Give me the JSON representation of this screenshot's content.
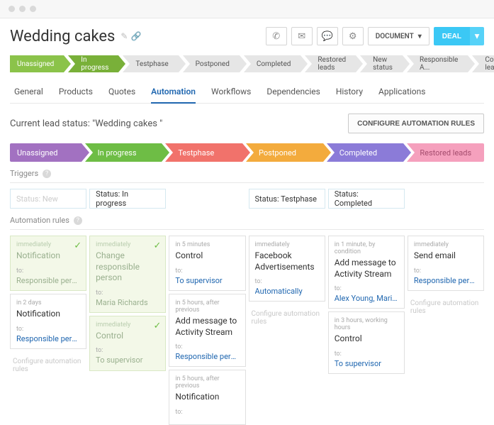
{
  "header": {
    "title": "Wedding cakes",
    "document_btn": "DOCUMENT",
    "deal_btn": "DEAL"
  },
  "top_stages": [
    {
      "label": "Unassigned",
      "cls": "green"
    },
    {
      "label": "In progress",
      "cls": "green dark"
    },
    {
      "label": "Testphase",
      "cls": ""
    },
    {
      "label": "Postponed",
      "cls": ""
    },
    {
      "label": "Completed",
      "cls": ""
    },
    {
      "label": "Restored leads",
      "cls": ""
    },
    {
      "label": "New status",
      "cls": ""
    },
    {
      "label": "Responsible A...",
      "cls": ""
    },
    {
      "label": "Complete lead",
      "cls": ""
    }
  ],
  "tabs": [
    "General",
    "Products",
    "Quotes",
    "Automation",
    "Workflows",
    "Dependencies",
    "History",
    "Applications"
  ],
  "active_tab": "Automation",
  "status_text": "Current lead status: \"Wedding cakes \"",
  "config_btn": "CONFIGURE AUTOMATION RULES",
  "stage_columns": [
    {
      "label": "Unassigned",
      "cls": "c-purple"
    },
    {
      "label": "In progress",
      "cls": "c-green"
    },
    {
      "label": "Testphase",
      "cls": "c-red"
    },
    {
      "label": "Postponed",
      "cls": "c-orange"
    },
    {
      "label": "Completed",
      "cls": "c-violet"
    },
    {
      "label": "Restored leads",
      "cls": "c-pink"
    }
  ],
  "triggers_label": "Triggers",
  "rules_label": "Automation rules",
  "ghost": "Configure automation rules",
  "to_label": "to:",
  "columns": [
    {
      "trigger": {
        "text": "Status: New",
        "faded": true
      },
      "cards": [
        {
          "done": true,
          "timing": "immediately",
          "title": "Notification",
          "to": "Responsible person"
        },
        {
          "done": false,
          "timing": "in 2 days",
          "title": "Notification",
          "to": "Responsible person"
        }
      ],
      "tail_ghost": true
    },
    {
      "trigger": {
        "text": "Status: In progress",
        "faded": false
      },
      "cards": [
        {
          "done": true,
          "timing": "immediately",
          "title": "Change responsible person",
          "to": "Maria Richards"
        },
        {
          "done": true,
          "timing": "immediately",
          "title": "Control",
          "to": "To supervisor"
        }
      ],
      "tail_ghost": false
    },
    {
      "trigger": null,
      "cards": [
        {
          "done": false,
          "timing": "in 5 minutes",
          "title": "Control",
          "to": "To supervisor"
        },
        {
          "done": false,
          "timing": "in 5 hours, after previous",
          "title": "Add message to Activity Stream",
          "to": "Responsible person"
        },
        {
          "done": false,
          "timing": "in 5 hours, after previous",
          "title": "Notification",
          "to": ""
        }
      ],
      "tail_ghost": false
    },
    {
      "trigger": {
        "text": "Status: Testphase",
        "faded": false
      },
      "cards": [
        {
          "done": false,
          "timing": "immediately",
          "title": "Facebook Advertisements",
          "to": "Automatically"
        }
      ],
      "tail_ghost": true
    },
    {
      "trigger": {
        "text": "Status: Completed",
        "faded": false
      },
      "cards": [
        {
          "done": false,
          "timing": "in 1 minute, by condition",
          "title": "Add message to Activity Stream",
          "to": "Alex Young, Maria ..."
        },
        {
          "done": false,
          "timing": "in 3 hours, working hours",
          "title": "Control",
          "to": "To supervisor"
        }
      ],
      "tail_ghost": false
    },
    {
      "trigger": null,
      "cards": [
        {
          "done": false,
          "timing": "immediately",
          "title": "Send email",
          "to": "Responsible person"
        }
      ],
      "tail_ghost": true
    }
  ]
}
